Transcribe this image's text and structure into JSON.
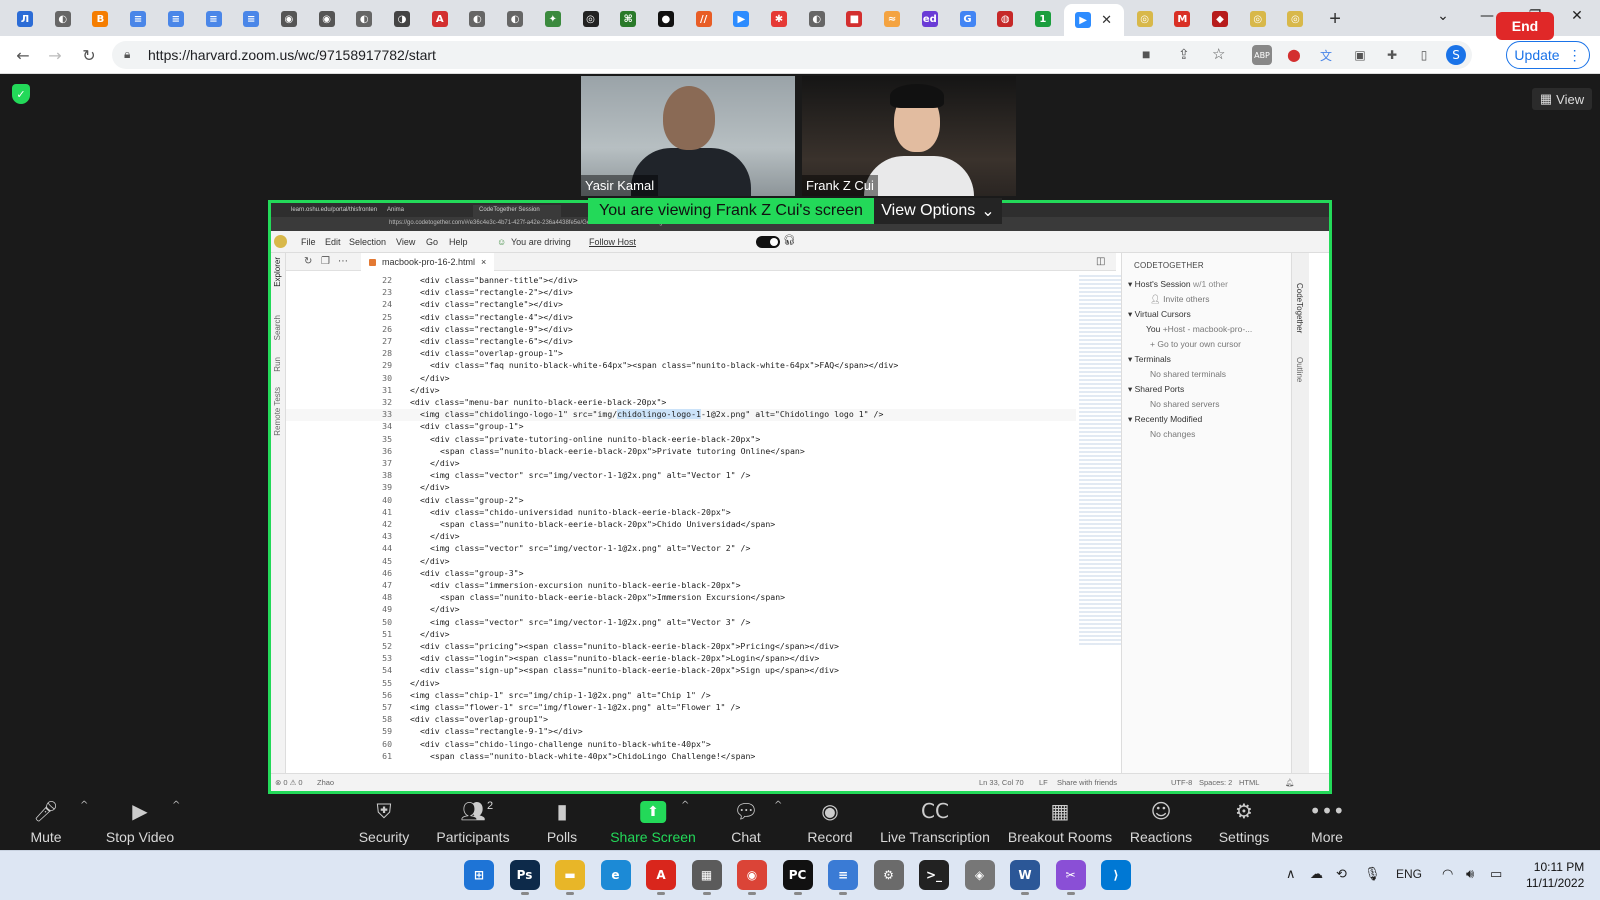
{
  "browser": {
    "url": "https://harvard.zoom.us/wc/97158917782/start",
    "update_label": "Update",
    "profile_initial": "S",
    "tabs": [
      {
        "icon": "Л",
        "color": "#2b6cd6"
      },
      {
        "icon": "◐",
        "color": "#666"
      },
      {
        "icon": "B",
        "color": "#f57d00"
      },
      {
        "icon": "≡",
        "color": "#4a86e8"
      },
      {
        "icon": "≡",
        "color": "#4a86e8"
      },
      {
        "icon": "≡",
        "color": "#4a86e8"
      },
      {
        "icon": "≡",
        "color": "#4a86e8"
      },
      {
        "icon": "◉",
        "color": "#555"
      },
      {
        "icon": "◉",
        "color": "#555"
      },
      {
        "icon": "◐",
        "color": "#666"
      },
      {
        "icon": "◑",
        "color": "#444"
      },
      {
        "icon": "A",
        "color": "#d32f2f"
      },
      {
        "icon": "◐",
        "color": "#666"
      },
      {
        "icon": "◐",
        "color": "#666"
      },
      {
        "icon": "✦",
        "color": "#3b8a3e"
      },
      {
        "icon": "◎",
        "color": "#222"
      },
      {
        "icon": "⌘",
        "color": "#2a7a2a"
      },
      {
        "icon": "●",
        "color": "#111"
      },
      {
        "icon": "//",
        "color": "#e85d26"
      },
      {
        "icon": "▶",
        "color": "#2d8cff"
      },
      {
        "icon": "✱",
        "color": "#e53935"
      },
      {
        "icon": "◐",
        "color": "#666"
      },
      {
        "icon": "■",
        "color": "#d32f2f"
      },
      {
        "icon": "≈",
        "color": "#f4a340"
      },
      {
        "icon": "ed",
        "color": "#6a3bd6"
      },
      {
        "icon": "G",
        "color": "#4285f4"
      },
      {
        "icon": "◍",
        "color": "#c62828"
      },
      {
        "icon": "1",
        "color": "#1b9e3e"
      }
    ],
    "tabs_after": [
      {
        "icon": "◎",
        "color": "#d8b84a"
      },
      {
        "icon": "M",
        "color": "#d93025"
      },
      {
        "icon": "◆",
        "color": "#b71c1c"
      },
      {
        "icon": "◎",
        "color": "#d8b84a"
      },
      {
        "icon": "◎",
        "color": "#d8b84a"
      }
    ]
  },
  "meeting": {
    "view_label": "View",
    "participants_video": [
      {
        "name": "Yasir Kamal"
      },
      {
        "name": "Frank Z Cui"
      }
    ],
    "share_banner": "You are viewing Frank Z Cui's screen",
    "view_options": "View Options"
  },
  "ide": {
    "inner_tabs": [
      "learn.oshu.edu/portal/thisfrontend/f...",
      "Anima",
      "CodeTogether Session"
    ],
    "inner_url": "https://go.codetogether.com/#/e36c4e3c-4b71-427f-a42e-236a4438fe5e/GeDbcf22e6WFMTCWR62Jlgs",
    "menu": [
      "File",
      "Edit",
      "Selection",
      "View",
      "Go",
      "Help"
    ],
    "driving_text": "You are driving",
    "follow_host": "Follow Host",
    "activity_labels": [
      "Explorer",
      "Search",
      "Run",
      "Remote Tests"
    ],
    "file_tab": "macbook-pro-16-2.html",
    "code_lines": [
      {
        "n": "22",
        "indent": 1,
        "t": "<div class=\"banner-title\"></div>"
      },
      {
        "n": "23",
        "indent": 1,
        "t": "<div class=\"rectangle-2\"></div>"
      },
      {
        "n": "24",
        "indent": 1,
        "t": "<div class=\"rectangle\"></div>"
      },
      {
        "n": "25",
        "indent": 1,
        "t": "<div class=\"rectangle-4\"></div>"
      },
      {
        "n": "26",
        "indent": 1,
        "t": "<div class=\"rectangle-9\"></div>"
      },
      {
        "n": "27",
        "indent": 1,
        "t": "<div class=\"rectangle-6\"></div>"
      },
      {
        "n": "28",
        "indent": 1,
        "t": "<div class=\"overlap-group-1\">"
      },
      {
        "n": "29",
        "indent": 2,
        "t": "<div class=\"faq nunito-black-white-64px\"><span class=\"nunito-black-white-64px\">FAQ</span></div>"
      },
      {
        "n": "30",
        "indent": 1,
        "t": "</div>"
      },
      {
        "n": "31",
        "indent": 0,
        "t": "</div>"
      },
      {
        "n": "32",
        "indent": 0,
        "t": "<div class=\"menu-bar nunito-black-eerie-black-20px\">"
      },
      {
        "n": "33",
        "indent": 1,
        "t": "<img class=\"chidolingo-logo-1\" src=\"img/chidolingo-logo-1-1@2x.png\" alt=\"Chidolingo logo 1\" />",
        "current": true
      },
      {
        "n": "34",
        "indent": 1,
        "t": "<div class=\"group-1\">"
      },
      {
        "n": "35",
        "indent": 2,
        "t": "<div class=\"private-tutoring-online nunito-black-eerie-black-20px\">"
      },
      {
        "n": "36",
        "indent": 3,
        "t": "<span class=\"nunito-black-eerie-black-20px\">Private tutoring Online</span>"
      },
      {
        "n": "37",
        "indent": 2,
        "t": "</div>"
      },
      {
        "n": "38",
        "indent": 2,
        "t": "<img class=\"vector\" src=\"img/vector-1-1@2x.png\" alt=\"Vector 1\" />"
      },
      {
        "n": "39",
        "indent": 1,
        "t": "</div>"
      },
      {
        "n": "40",
        "indent": 1,
        "t": "<div class=\"group-2\">"
      },
      {
        "n": "41",
        "indent": 2,
        "t": "<div class=\"chido-universidad nunito-black-eerie-black-20px\">"
      },
      {
        "n": "42",
        "indent": 3,
        "t": "<span class=\"nunito-black-eerie-black-20px\">Chido Universidad</span>"
      },
      {
        "n": "43",
        "indent": 2,
        "t": "</div>"
      },
      {
        "n": "44",
        "indent": 2,
        "t": "<img class=\"vector\" src=\"img/vector-1-1@2x.png\" alt=\"Vector 2\" />"
      },
      {
        "n": "45",
        "indent": 1,
        "t": "</div>"
      },
      {
        "n": "46",
        "indent": 1,
        "t": "<div class=\"group-3\">"
      },
      {
        "n": "47",
        "indent": 2,
        "t": "<div class=\"immersion-excursion nunito-black-eerie-black-20px\">"
      },
      {
        "n": "48",
        "indent": 3,
        "t": "<span class=\"nunito-black-eerie-black-20px\">Immersion Excursion</span>"
      },
      {
        "n": "49",
        "indent": 2,
        "t": "</div>"
      },
      {
        "n": "50",
        "indent": 2,
        "t": "<img class=\"vector\" src=\"img/vector-1-1@2x.png\" alt=\"Vector 3\" />"
      },
      {
        "n": "51",
        "indent": 1,
        "t": "</div>"
      },
      {
        "n": "52",
        "indent": 1,
        "t": "<div class=\"pricing\"><span class=\"nunito-black-eerie-black-20px\">Pricing</span></div>"
      },
      {
        "n": "53",
        "indent": 1,
        "t": "<div class=\"login\"><span class=\"nunito-black-eerie-black-20px\">Login</span></div>"
      },
      {
        "n": "54",
        "indent": 1,
        "t": "<div class=\"sign-up\"><span class=\"nunito-black-eerie-black-20px\">Sign up</span></div>"
      },
      {
        "n": "55",
        "indent": 0,
        "t": "</div>"
      },
      {
        "n": "56",
        "indent": 0,
        "t": "<img class=\"chip-1\" src=\"img/chip-1-1@2x.png\" alt=\"Chip 1\" />"
      },
      {
        "n": "57",
        "indent": 0,
        "t": "<img class=\"flower-1\" src=\"img/flower-1-1@2x.png\" alt=\"Flower 1\" />"
      },
      {
        "n": "58",
        "indent": 0,
        "t": "<div class=\"overlap-group1\">"
      },
      {
        "n": "59",
        "indent": 1,
        "t": "<div class=\"rectangle-9-1\"></div>"
      },
      {
        "n": "60",
        "indent": 1,
        "t": "<div class=\"chido-lingo-challenge nunito-black-white-40px\">"
      },
      {
        "n": "61",
        "indent": 2,
        "t": "<span class=\"nunito-black-white-40px\">ChidoLingo Challenge!</span>"
      }
    ],
    "panel": {
      "header": "CODETOGETHER",
      "session": "Host's Session",
      "session_count": "w/1 other",
      "invite": "Invite others",
      "virtual_cursors": "Virtual Cursors",
      "you": "You",
      "you_detail": "+Host - macbook-pro-...",
      "go_cursor": "Go to your own cursor",
      "terminals": "Terminals",
      "no_terminals": "No shared terminals",
      "shared_ports": "Shared Ports",
      "no_servers": "No shared servers",
      "recently_modified": "Recently Modified",
      "no_changes": "No changes"
    },
    "side_strip_labels": [
      "CodeTogether",
      "Outline"
    ],
    "status": {
      "problems": "⊗ 0 ⚠ 0",
      "user": "Zhao",
      "position": "Ln 33, Col 70",
      "eol": "LF",
      "share": "Share with friends",
      "encoding": "UTF-8",
      "spaces": "Spaces: 2",
      "lang": "HTML"
    }
  },
  "controls": [
    {
      "label": "Mute",
      "icon": "🎤︎",
      "caret": true
    },
    {
      "label": "Stop Video",
      "icon": "▶",
      "caret": true
    },
    {
      "label": "Security",
      "icon": "⛨"
    },
    {
      "label": "Participants",
      "icon": "👥︎",
      "badge": "2"
    },
    {
      "label": "Polls",
      "icon": "▮"
    },
    {
      "label": "Share Screen",
      "icon": "⬆",
      "caret": true
    },
    {
      "label": "Chat",
      "icon": "💬︎",
      "caret": true
    },
    {
      "label": "Record",
      "icon": "◉"
    },
    {
      "label": "Live Transcription",
      "icon": "CC"
    },
    {
      "label": "Breakout Rooms",
      "icon": "▦"
    },
    {
      "label": "Reactions",
      "icon": "☺"
    },
    {
      "label": "Settings",
      "icon": "⚙"
    },
    {
      "label": "More",
      "icon": "•••"
    }
  ],
  "end_label": "End",
  "taskbar": {
    "apps": [
      {
        "name": "windows-start-icon",
        "icon": "⊞",
        "color": "#1e74d6"
      },
      {
        "name": "photoshop-icon",
        "icon": "Ps",
        "color": "#0d2a4a",
        "running": true
      },
      {
        "name": "file-explorer-icon",
        "icon": "▬",
        "color": "#e8b628",
        "running": true
      },
      {
        "name": "edge-icon",
        "icon": "e",
        "color": "#1c8ad6"
      },
      {
        "name": "acrobat-icon",
        "icon": "A",
        "color": "#d9261c",
        "running": true
      },
      {
        "name": "calculator-icon",
        "icon": "▦",
        "color": "#5b5b5b",
        "running": true
      },
      {
        "name": "chrome-icon",
        "icon": "◉",
        "color": "#db4437",
        "running": true
      },
      {
        "name": "pycharm-icon",
        "icon": "PC",
        "color": "#111",
        "running": true
      },
      {
        "name": "notepad-icon",
        "icon": "≡",
        "color": "#3a7bd5",
        "running": true
      },
      {
        "name": "settings-icon",
        "icon": "⚙",
        "color": "#6b6b6b"
      },
      {
        "name": "terminal-icon",
        "icon": ">_",
        "color": "#222"
      },
      {
        "name": "app-icon",
        "icon": "◈",
        "color": "#777"
      },
      {
        "name": "word-icon",
        "icon": "W",
        "color": "#2b5797",
        "running": true
      },
      {
        "name": "snipping-tool-icon",
        "icon": "✂",
        "color": "#8a4fd6",
        "running": true
      },
      {
        "name": "vscode-icon",
        "icon": "⟩",
        "color": "#0078d4"
      }
    ],
    "language": "ENG",
    "time": "10:11 PM",
    "date": "11/11/2022"
  }
}
